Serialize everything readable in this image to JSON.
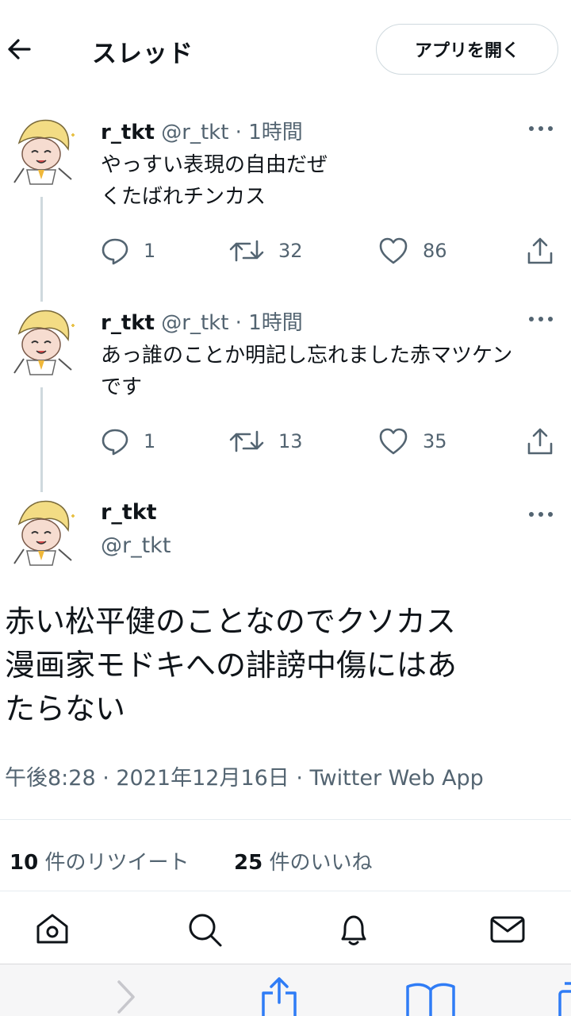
{
  "header": {
    "title": "スレッド",
    "open_app_label": "アプリを開く"
  },
  "tweets": [
    {
      "name": "r_tkt",
      "handle": "@r_tkt",
      "separator": "·",
      "time": "1時間",
      "lines": [
        "やっすい表現の自由だぜ",
        "くたばれチンカス"
      ],
      "replies": "1",
      "retweets": "32",
      "likes": "86"
    },
    {
      "name": "r_tkt",
      "handle": "@r_tkt",
      "separator": "·",
      "time": "1時間",
      "lines": [
        "あっ誰のことか明記し忘れました赤マツケン",
        "です"
      ],
      "replies": "1",
      "retweets": "13",
      "likes": "35"
    }
  ],
  "focus": {
    "name": "r_tkt",
    "handle": "@r_tkt",
    "lines": [
      "赤い松平健のことなのでクソカス",
      "漫画家モドキへの誹謗中傷にはあ",
      "たらない"
    ],
    "meta": "午後8:28 · 2021年12月16日 · Twitter Web App",
    "retweet_count": "10",
    "retweet_label": "件のリツイート",
    "like_count": "25",
    "like_label": "件のいいね"
  },
  "icons": {
    "back": "back-arrow-icon",
    "more": "more-dots-icon",
    "reply": "reply-icon",
    "retweet": "retweet-icon",
    "like": "heart-icon",
    "share": "share-icon",
    "tab_home": "home-icon",
    "tab_search": "search-icon",
    "tab_notifications": "bell-icon",
    "tab_messages": "mail-icon"
  },
  "colors": {
    "text": "#0f1419",
    "secondary": "#536471",
    "border": "#cfd9de",
    "safari_blue": "#2f7cf6"
  }
}
